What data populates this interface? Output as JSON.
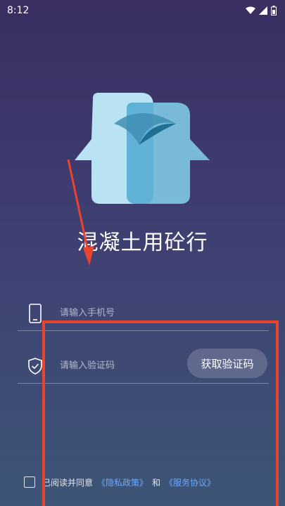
{
  "status_bar": {
    "time": "8:12",
    "icons": [
      "wifi-icon",
      "signal-icon",
      "battery-icon"
    ]
  },
  "app": {
    "name": "混凝土用砼行",
    "logo": "two-heads-logo"
  },
  "login": {
    "phone_placeholder": "请输入手机号",
    "phone_value": "",
    "code_placeholder": "请输入验证码",
    "code_value": "",
    "get_code_label": "获取验证码"
  },
  "agreement": {
    "checked": false,
    "prefix": "已阅读并同意",
    "privacy_link": "《隐私政策》",
    "conjunction": "和",
    "service_link": "《服务协议》"
  },
  "colors": {
    "background_top": "#3a2e62",
    "background_bottom": "#3d5577",
    "link": "#6aa8ff",
    "annotation": "#e8442e"
  }
}
